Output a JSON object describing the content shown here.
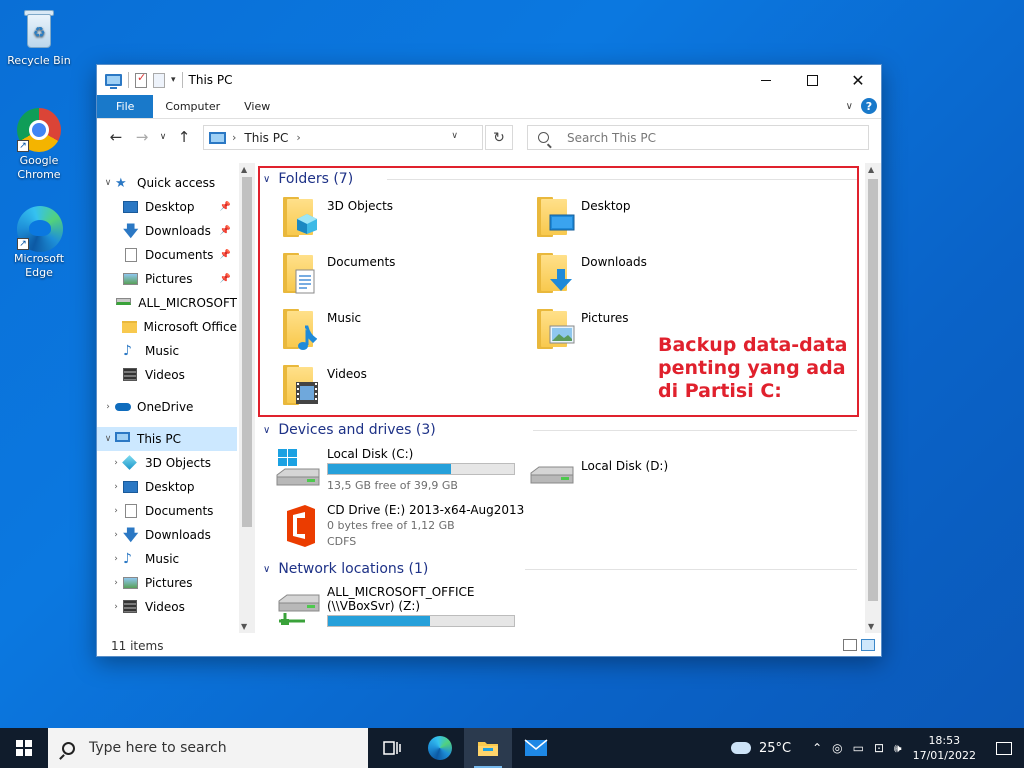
{
  "desktop": {
    "icons": [
      {
        "label": "Recycle Bin",
        "icon": "recycle-bin-icon"
      },
      {
        "label": "Google Chrome",
        "icon": "chrome-icon"
      },
      {
        "label": "Microsoft Edge",
        "icon": "edge-icon"
      }
    ]
  },
  "window": {
    "title": "This PC",
    "ribbon_tabs": [
      "File",
      "Computer",
      "View"
    ],
    "address": {
      "crumb": "This PC"
    },
    "search": {
      "placeholder": "Search This PC"
    },
    "nav": [
      {
        "label": "Quick access",
        "icon": "star-icon",
        "expand": "down",
        "indent": 0
      },
      {
        "label": "Desktop",
        "icon": "desktop-folder-icon",
        "pinned": true,
        "indent": 1
      },
      {
        "label": "Downloads",
        "icon": "downloads-icon",
        "pinned": true,
        "indent": 1
      },
      {
        "label": "Documents",
        "icon": "documents-icon",
        "pinned": true,
        "indent": 1
      },
      {
        "label": "Pictures",
        "icon": "pictures-icon",
        "pinned": true,
        "indent": 1
      },
      {
        "label": "ALL_MICROSOFT",
        "icon": "network-drive-icon",
        "indent": 1
      },
      {
        "label": "Microsoft Office",
        "icon": "folder-icon",
        "indent": 1
      },
      {
        "label": "Music",
        "icon": "music-icon",
        "indent": 1
      },
      {
        "label": "Videos",
        "icon": "videos-icon",
        "indent": 1
      },
      {
        "label": "OneDrive",
        "icon": "onedrive-icon",
        "expand": "right",
        "indent": 0,
        "gap": true
      },
      {
        "label": "This PC",
        "icon": "this-pc-icon",
        "expand": "down",
        "indent": 0,
        "selected": true,
        "gap": true
      },
      {
        "label": "3D Objects",
        "icon": "3d-objects-icon",
        "expand": "right",
        "indent": 1
      },
      {
        "label": "Desktop",
        "icon": "desktop-folder-icon",
        "expand": "right",
        "indent": 1
      },
      {
        "label": "Documents",
        "icon": "documents-icon",
        "expand": "right",
        "indent": 1
      },
      {
        "label": "Downloads",
        "icon": "downloads-icon",
        "expand": "right",
        "indent": 1
      },
      {
        "label": "Music",
        "icon": "music-icon",
        "expand": "right",
        "indent": 1
      },
      {
        "label": "Pictures",
        "icon": "pictures-icon",
        "expand": "right",
        "indent": 1
      },
      {
        "label": "Videos",
        "icon": "videos-icon",
        "expand": "right",
        "indent": 1
      }
    ],
    "groups": {
      "folders": "Folders (7)",
      "devices": "Devices and drives (3)",
      "network": "Network locations (1)"
    },
    "folders": [
      {
        "label": "3D Objects",
        "icon": "3d-objects-folder-icon"
      },
      {
        "label": "Desktop",
        "icon": "desktop-folder-icon"
      },
      {
        "label": "Documents",
        "icon": "documents-folder-icon"
      },
      {
        "label": "Downloads",
        "icon": "downloads-folder-icon"
      },
      {
        "label": "Music",
        "icon": "music-folder-icon"
      },
      {
        "label": "Pictures",
        "icon": "pictures-folder-icon"
      },
      {
        "label": "Videos",
        "icon": "videos-folder-icon"
      }
    ],
    "drives": [
      {
        "name": "Local Disk (C:)",
        "free": "13,5 GB free of 39,9 GB",
        "used_fraction": 0.66,
        "icon": "local-disk-windows-icon"
      },
      {
        "name": "Local Disk (D:)",
        "icon": "local-disk-icon"
      },
      {
        "name": "CD Drive (E:) 2013-x64-Aug2013",
        "free": "0 bytes free of 1,12 GB",
        "fs": "CDFS",
        "icon": "office-cd-icon"
      }
    ],
    "network_locations": [
      {
        "name_line1": "ALL_MICROSOFT_OFFICE",
        "name_line2": "(\\\\VBoxSvr) (Z:)",
        "used_fraction": 0.55,
        "icon": "network-drive-icon"
      }
    ],
    "status": "11 items"
  },
  "annotation": {
    "line1": "Backup data-data",
    "line2": "penting yang ada",
    "line3": "di Partisi C:",
    "color": "#e0212d"
  },
  "taskbar": {
    "search_placeholder": "Type here to search",
    "weather": "25°C",
    "time": "18:53",
    "date": "17/01/2022"
  }
}
